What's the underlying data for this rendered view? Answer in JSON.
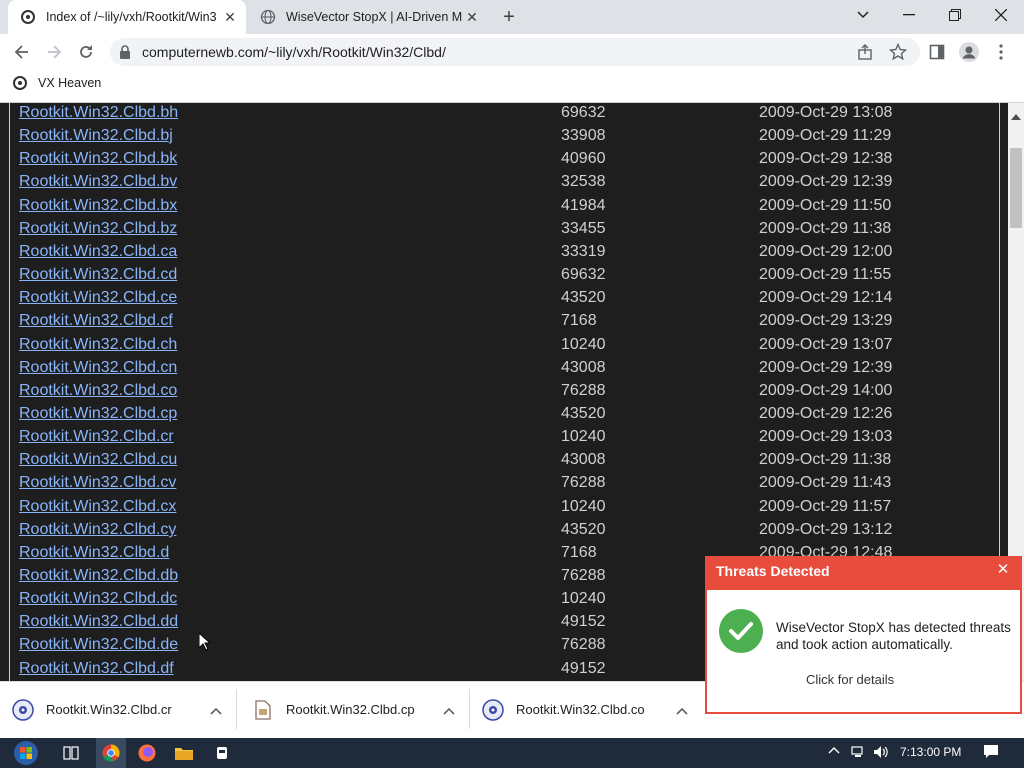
{
  "browser": {
    "tabs": [
      {
        "title": "Index of /~lily/vxh/Rootkit/Win3",
        "active": true
      },
      {
        "title": "WiseVector StopX | AI-Driven Ma",
        "active": false
      }
    ],
    "url": "computernewb.com/~lily/vxh/Rootkit/Win32/Clbd/",
    "bookmark": "VX Heaven"
  },
  "listing": [
    {
      "name": "Rootkit.Win32.Clbd.bh",
      "size": "69632",
      "date": "2009-Oct-29 13:08"
    },
    {
      "name": "Rootkit.Win32.Clbd.bj",
      "size": "33908",
      "date": "2009-Oct-29 11:29"
    },
    {
      "name": "Rootkit.Win32.Clbd.bk",
      "size": "40960",
      "date": "2009-Oct-29 12:38"
    },
    {
      "name": "Rootkit.Win32.Clbd.bv",
      "size": "32538",
      "date": "2009-Oct-29 12:39"
    },
    {
      "name": "Rootkit.Win32.Clbd.bx",
      "size": "41984",
      "date": "2009-Oct-29 11:50"
    },
    {
      "name": "Rootkit.Win32.Clbd.bz",
      "size": "33455",
      "date": "2009-Oct-29 11:38"
    },
    {
      "name": "Rootkit.Win32.Clbd.ca",
      "size": "33319",
      "date": "2009-Oct-29 12:00"
    },
    {
      "name": "Rootkit.Win32.Clbd.cd",
      "size": "69632",
      "date": "2009-Oct-29 11:55"
    },
    {
      "name": "Rootkit.Win32.Clbd.ce",
      "size": "43520",
      "date": "2009-Oct-29 12:14"
    },
    {
      "name": "Rootkit.Win32.Clbd.cf",
      "size": "7168",
      "date": "2009-Oct-29 13:29"
    },
    {
      "name": "Rootkit.Win32.Clbd.ch",
      "size": "10240",
      "date": "2009-Oct-29 13:07"
    },
    {
      "name": "Rootkit.Win32.Clbd.cn",
      "size": "43008",
      "date": "2009-Oct-29 12:39"
    },
    {
      "name": "Rootkit.Win32.Clbd.co",
      "size": "76288",
      "date": "2009-Oct-29 14:00"
    },
    {
      "name": "Rootkit.Win32.Clbd.cp",
      "size": "43520",
      "date": "2009-Oct-29 12:26"
    },
    {
      "name": "Rootkit.Win32.Clbd.cr",
      "size": "10240",
      "date": "2009-Oct-29 13:03"
    },
    {
      "name": "Rootkit.Win32.Clbd.cu",
      "size": "43008",
      "date": "2009-Oct-29 11:38"
    },
    {
      "name": "Rootkit.Win32.Clbd.cv",
      "size": "76288",
      "date": "2009-Oct-29 11:43"
    },
    {
      "name": "Rootkit.Win32.Clbd.cx",
      "size": "10240",
      "date": "2009-Oct-29 11:57"
    },
    {
      "name": "Rootkit.Win32.Clbd.cy",
      "size": "43520",
      "date": "2009-Oct-29 13:12"
    },
    {
      "name": "Rootkit.Win32.Clbd.d",
      "size": "7168",
      "date": "2009-Oct-29 12:48"
    },
    {
      "name": "Rootkit.Win32.Clbd.db",
      "size": "76288",
      "date": ""
    },
    {
      "name": "Rootkit.Win32.Clbd.dc",
      "size": "10240",
      "date": ""
    },
    {
      "name": "Rootkit.Win32.Clbd.dd",
      "size": "49152",
      "date": ""
    },
    {
      "name": "Rootkit.Win32.Clbd.de",
      "size": "76288",
      "date": ""
    },
    {
      "name": "Rootkit.Win32.Clbd.df",
      "size": "49152",
      "date": ""
    }
  ],
  "downloads": [
    {
      "name": "Rootkit.Win32.Clbd.cr"
    },
    {
      "name": "Rootkit.Win32.Clbd.cp"
    },
    {
      "name": "Rootkit.Win32.Clbd.co"
    }
  ],
  "popup": {
    "title": "Threats Detected",
    "message": "WiseVector StopX has detected threats and took action automatically.",
    "link": "Click for details"
  },
  "taskbar": {
    "clock": "7:13:00 PM"
  },
  "colors": {
    "link": "#8ab4f8",
    "alert": "#e74c3c",
    "success": "#4caf50"
  }
}
